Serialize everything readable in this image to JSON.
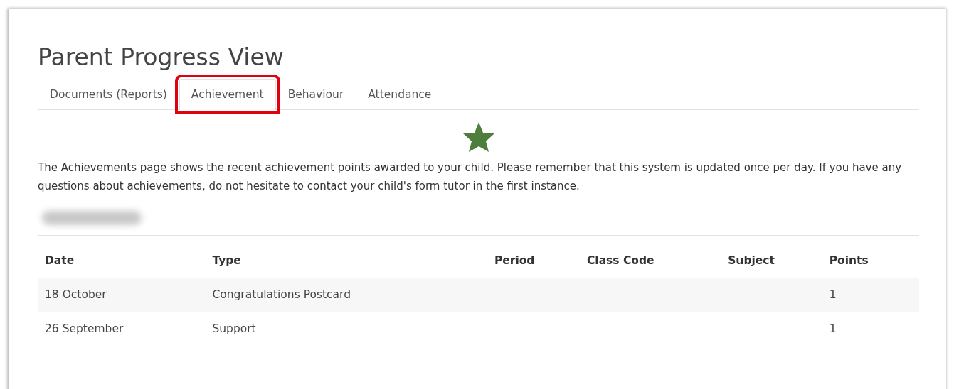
{
  "page": {
    "title": "Parent Progress View"
  },
  "tabs": [
    {
      "label": "Documents (Reports)",
      "selected": false,
      "highlighted": false
    },
    {
      "label": "Achievement",
      "selected": true,
      "highlighted": true
    },
    {
      "label": "Behaviour",
      "selected": false,
      "highlighted": false
    },
    {
      "label": "Attendance",
      "selected": false,
      "highlighted": false
    }
  ],
  "intro": "The Achievements page shows the recent achievement points awarded to your child. Please remember that this system is updated once per day. If you have any questions about achievements, do not hesitate to contact your child's form tutor in the first instance.",
  "student": {
    "name_redacted": true
  },
  "table": {
    "columns": [
      "Date",
      "Type",
      "Period",
      "Class Code",
      "Subject",
      "Points"
    ],
    "rows": [
      [
        "18 October",
        "Congratulations Postcard",
        "",
        "",
        "",
        "1"
      ],
      [
        "26 September",
        "Support",
        "",
        "",
        "",
        "1"
      ]
    ]
  }
}
